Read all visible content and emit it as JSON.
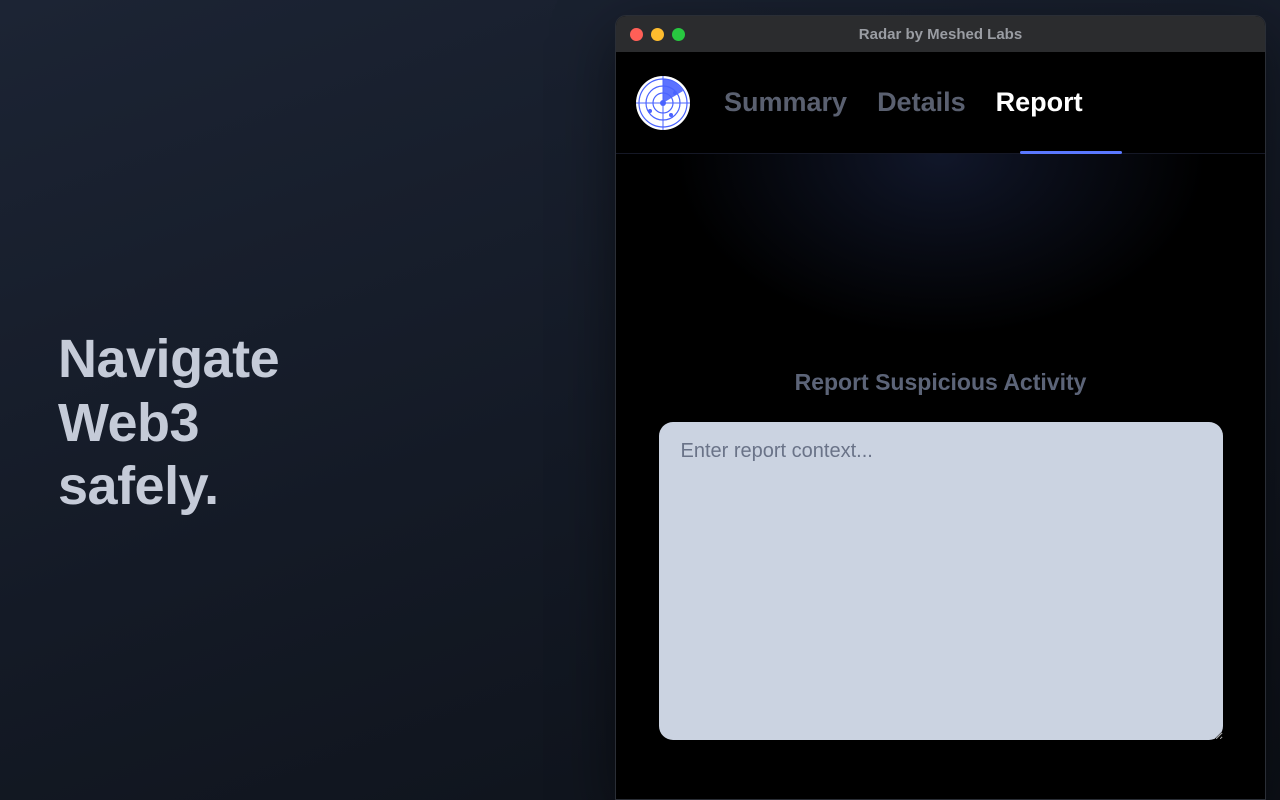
{
  "marketing": {
    "tagline_line1": "Navigate",
    "tagline_line2": "Web3",
    "tagline_line3": "safely."
  },
  "window": {
    "title": "Radar by Meshed Labs"
  },
  "tabs": [
    {
      "label": "Summary",
      "active": false
    },
    {
      "label": "Details",
      "active": false
    },
    {
      "label": "Report",
      "active": true
    }
  ],
  "content": {
    "report": {
      "heading": "Report Suspicious Activity",
      "placeholder": "Enter report context...",
      "value": ""
    }
  },
  "colors": {
    "accent": "#5a78ff",
    "textarea_bg": "#cbd3e1",
    "inactive_tab": "#5a6070"
  },
  "icons": {
    "logo": "radar-icon"
  }
}
